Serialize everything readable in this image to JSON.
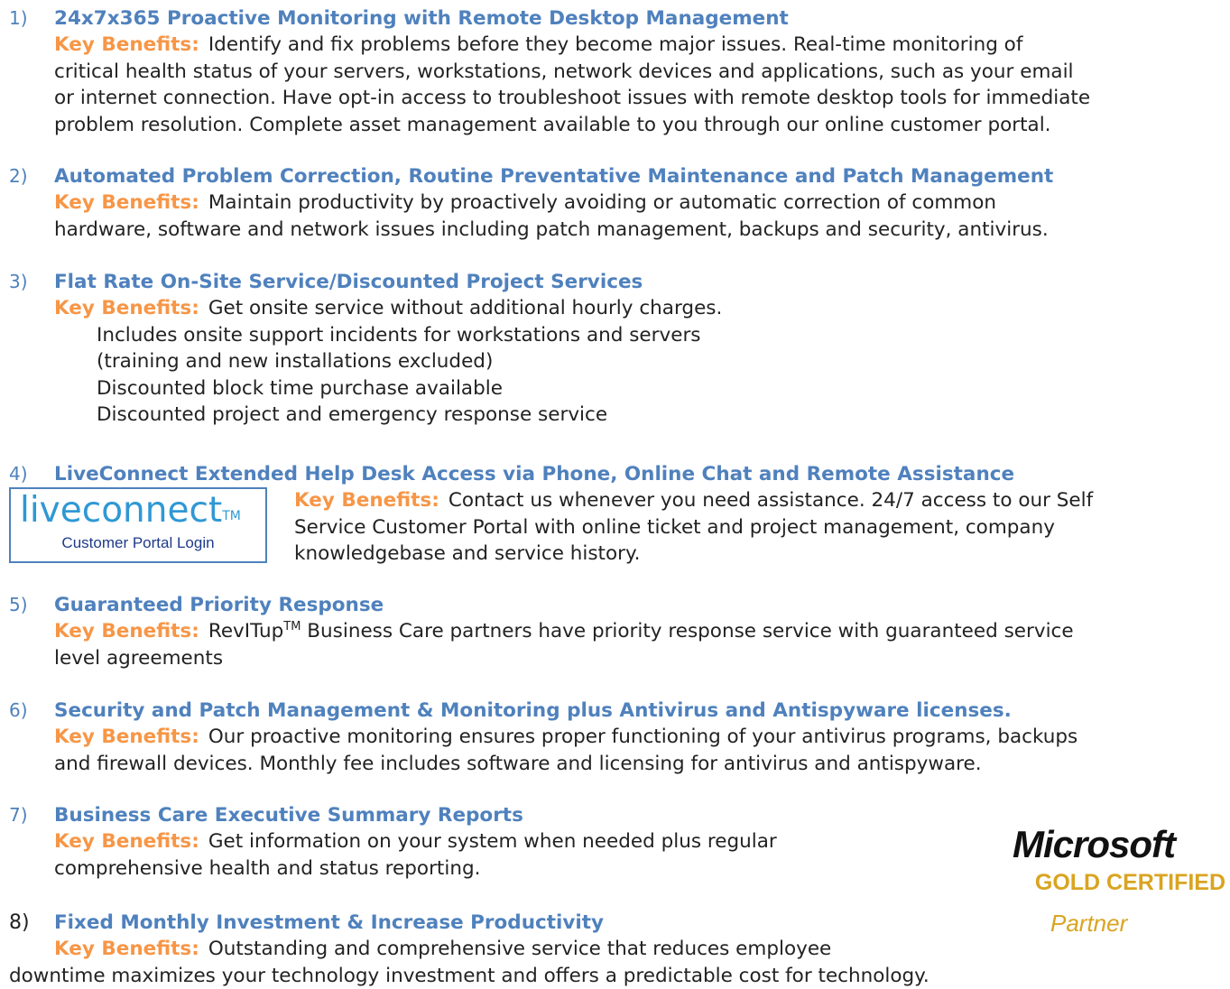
{
  "key_benefits_label": "Key Benefits:",
  "items": [
    {
      "number": "1)",
      "title": "24x7x365 Proactive Monitoring with Remote Desktop Management",
      "lines": [
        "Identify and fix problems before they become major issues.  Real-time monitoring of",
        "critical health status of your servers, workstations, network devices and applications, such as your email",
        "or internet connection. Have opt-in access to troubleshoot issues with remote desktop tools for immediate",
        "problem resolution.  Complete asset management available to you through our online customer portal."
      ]
    },
    {
      "number": "2)",
      "title": "Automated Problem Correction, Routine Preventative Maintenance and Patch Management",
      "lines": [
        "Maintain productivity by proactively avoiding or automatic correction of common",
        "hardware, software and network issues including patch management, backups and security, antivirus."
      ]
    },
    {
      "number": "3)",
      "title": "Flat Rate On-Site Service/Discounted Project Services",
      "lines": [
        "Get onsite service without additional hourly charges."
      ],
      "sub_lines": [
        "Includes onsite support incidents for workstations and servers",
        "(training and new installations excluded)",
        "Discounted block time purchase available",
        "Discounted project and emergency response service"
      ]
    },
    {
      "number": "4)",
      "title": "LiveConnect Extended Help Desk Access via Phone, Online Chat and Remote Assistance",
      "lines": [
        "Contact us whenever you need assistance. 24/7 access to our Self",
        "Service Customer Portal with online ticket and project management, company",
        "knowledgebase and service history."
      ]
    },
    {
      "number": "5)",
      "title": "Guaranteed Priority Response",
      "brand": "RevITup",
      "tm": "TM",
      "lines": [
        " Business Care partners have priority response service with guaranteed service",
        "level agreements"
      ]
    },
    {
      "number": "6)",
      "title": "Security and Patch Management & Monitoring plus Antivirus and Antispyware licenses.",
      "lines": [
        "Our proactive monitoring ensures proper functioning of your antivirus programs, backups",
        "and firewall devices.  Monthly fee includes software and licensing for antivirus and antispyware."
      ]
    },
    {
      "number": "7)",
      "title": "Business Care Executive Summary Reports",
      "lines": [
        "Get information on your system when needed plus regular",
        "comprehensive health and status reporting."
      ]
    },
    {
      "number": "8)",
      "title": "Fixed Monthly Investment & Increase Productivity",
      "lines": [
        "Outstanding and comprehensive service that reduces employee",
        "downtime maximizes your technology investment and offers a predictable cost for technology."
      ]
    }
  ],
  "liveconnect_logo": {
    "wordmark": "liveconnect",
    "tm": "TM",
    "caption": "Customer Portal Login"
  },
  "microsoft_logo": {
    "wordmark": "Microsoft",
    "certification": "GOLD CERTIFIED",
    "partner": "Partner"
  }
}
